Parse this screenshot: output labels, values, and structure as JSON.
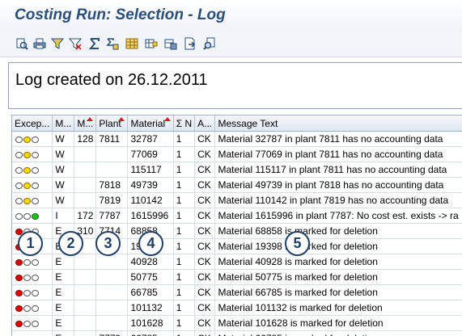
{
  "window": {
    "title": "Costing Run: Selection - Log"
  },
  "toolbar": {
    "buttons": [
      {
        "name": "details-icon"
      },
      {
        "name": "print-icon"
      },
      {
        "name": "filter-icon"
      },
      {
        "name": "delete-filter-icon"
      },
      {
        "name": "sum-icon"
      },
      {
        "name": "subtotal-icon"
      },
      {
        "name": "layout-icon"
      },
      {
        "name": "choose-layout-icon"
      },
      {
        "name": "save-layout-icon"
      },
      {
        "name": "export-icon"
      },
      {
        "name": "find-icon"
      }
    ]
  },
  "log": {
    "text": "Log created on 26.12.2011"
  },
  "grid": {
    "headers": [
      "Excep...",
      "M...",
      "M...",
      "Plant",
      "Material",
      "Σ N",
      "A...",
      "Message Text"
    ],
    "sorted_columns": [
      2,
      3,
      4
    ],
    "rows": [
      {
        "exception": "yellow",
        "m1": "W",
        "m2": "128",
        "plant": "7811",
        "material": "32787",
        "count": "1",
        "area": "CK",
        "message": "Material 32787 in plant 7811 has no accounting data"
      },
      {
        "exception": "yellow",
        "m1": "W",
        "m2": "",
        "plant": "",
        "material": "77069",
        "count": "1",
        "area": "CK",
        "message": "Material 77069 in plant 7811 has no accounting data"
      },
      {
        "exception": "yellow",
        "m1": "W",
        "m2": "",
        "plant": "",
        "material": "115117",
        "count": "1",
        "area": "CK",
        "message": "Material 115117 in plant 7811 has no accounting data"
      },
      {
        "exception": "yellow",
        "m1": "W",
        "m2": "",
        "plant": "7818",
        "material": "49739",
        "count": "1",
        "area": "CK",
        "message": "Material 49739 in plant 7818 has no accounting data"
      },
      {
        "exception": "yellow",
        "m1": "W",
        "m2": "",
        "plant": "7819",
        "material": "110142",
        "count": "1",
        "area": "CK",
        "message": "Material 110142 in plant 7819 has no accounting data"
      },
      {
        "exception": "green",
        "m1": "I",
        "m2": "172",
        "plant": "7787",
        "material": "1615996",
        "count": "1",
        "area": "CK",
        "message": "Material 1615996 in plant 7787: No cost est. exists -> ra"
      },
      {
        "exception": "red",
        "m1": "E",
        "m2": "310",
        "plant": "7714",
        "material": "68858",
        "count": "1",
        "area": "CK",
        "message": "Material 68858 is marked for deletion"
      },
      {
        "exception": "red",
        "m1": "E",
        "m2": "",
        "plant": "",
        "material": "19398",
        "count": "1",
        "area": "CK",
        "message": "Material 19398 is marked for deletion"
      },
      {
        "exception": "red",
        "m1": "E",
        "m2": "",
        "plant": "",
        "material": "40928",
        "count": "1",
        "area": "CK",
        "message": "Material 40928 is marked for deletion"
      },
      {
        "exception": "red",
        "m1": "E",
        "m2": "",
        "plant": "",
        "material": "50775",
        "count": "1",
        "area": "CK",
        "message": "Material 50775 is marked for deletion"
      },
      {
        "exception": "red",
        "m1": "E",
        "m2": "",
        "plant": "",
        "material": "66785",
        "count": "1",
        "area": "CK",
        "message": "Material 66785 is marked for deletion"
      },
      {
        "exception": "red",
        "m1": "E",
        "m2": "",
        "plant": "",
        "material": "101132",
        "count": "1",
        "area": "CK",
        "message": "Material 101132 is marked for deletion"
      },
      {
        "exception": "red",
        "m1": "E",
        "m2": "",
        "plant": "",
        "material": "101628",
        "count": "1",
        "area": "CK",
        "message": "Material 101628 is marked for deletion"
      },
      {
        "exception": "red",
        "m1": "E",
        "m2": "",
        "plant": "7779",
        "material": "66785",
        "count": "1",
        "area": "CK",
        "message": "Material 66785 is marked for deletion"
      }
    ]
  },
  "callouts": [
    "1",
    "2",
    "3",
    "4",
    "5"
  ],
  "colors": {
    "title": "#2a4f7a",
    "callout_border": "#1f3f66",
    "sort_arrow": "#d21f1f"
  }
}
